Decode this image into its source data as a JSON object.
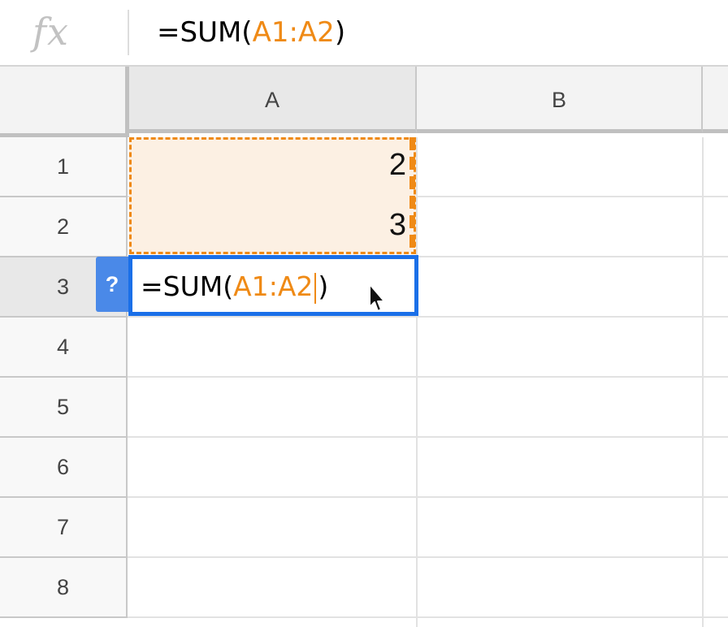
{
  "formula_bar": {
    "icon": "function-icon",
    "fx_label": "fx",
    "prefix": "=SUM(",
    "range_start": "A1",
    "separator": ":",
    "range_end": "A2",
    "suffix": ")"
  },
  "columns": [
    "A",
    "B"
  ],
  "rows": [
    "1",
    "2",
    "3",
    "4",
    "5",
    "6",
    "7",
    "8"
  ],
  "cells": {
    "A1": "2",
    "A2": "3"
  },
  "editor": {
    "help_label": "?",
    "prefix": "=SUM(",
    "range_start": "A1",
    "separator": ":",
    "range_end": "A2",
    "suffix": ")"
  },
  "colors": {
    "range_highlight": "#ef8a16",
    "editor_border": "#1a6fe8",
    "help_chip": "#4a89e8"
  }
}
